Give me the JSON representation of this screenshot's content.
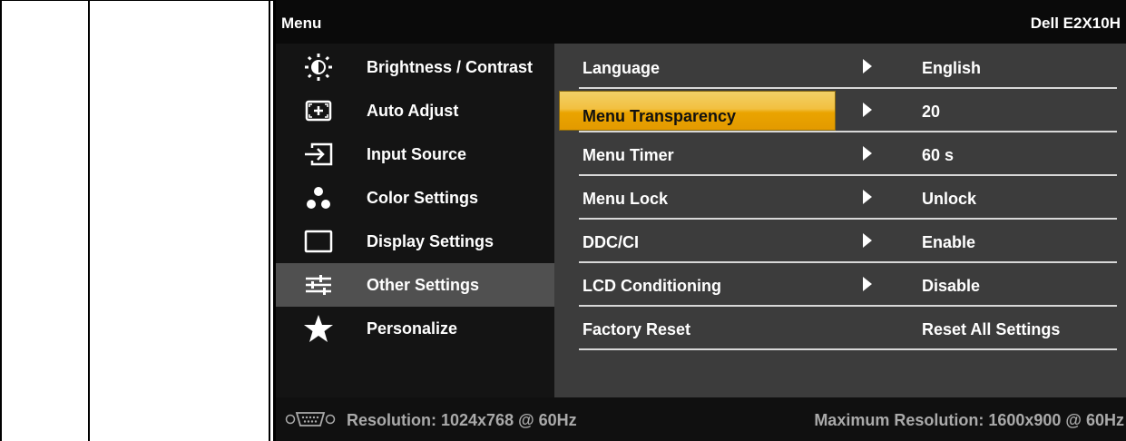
{
  "header": {
    "title": "Menu",
    "model": "Dell E2X10H"
  },
  "main_menu": [
    {
      "label": "Brightness / Contrast",
      "icon": "brightness-icon"
    },
    {
      "label": "Auto Adjust",
      "icon": "auto-adjust-icon"
    },
    {
      "label": "Input Source",
      "icon": "input-source-icon"
    },
    {
      "label": "Color Settings",
      "icon": "color-settings-icon"
    },
    {
      "label": "Display Settings",
      "icon": "display-settings-icon"
    },
    {
      "label": "Other Settings",
      "icon": "other-settings-icon",
      "selected": true
    },
    {
      "label": "Personalize",
      "icon": "star-icon"
    }
  ],
  "other_settings": [
    {
      "name": "Language",
      "value": "English",
      "has_arrow": true
    },
    {
      "name": "Menu Transparency",
      "value": "20",
      "has_arrow": true,
      "highlighted": true
    },
    {
      "name": "Menu Timer",
      "value": "60 s",
      "has_arrow": true
    },
    {
      "name": "Menu Lock",
      "value": "Unlock",
      "has_arrow": true
    },
    {
      "name": "DDC/CI",
      "value": "Enable",
      "has_arrow": true
    },
    {
      "name": "LCD Conditioning",
      "value": "Disable",
      "has_arrow": true
    },
    {
      "name": "Factory Reset",
      "value": "Reset All Settings",
      "has_arrow": false
    }
  ],
  "status": {
    "connector_icon": "vga-connector-icon",
    "resolution": "Resolution: 1024x768 @ 60Hz",
    "max_resolution": "Maximum Resolution: 1600x900 @ 60Hz"
  },
  "colors": {
    "highlight": "#eaa400",
    "title_bg": "#0a0a0a",
    "left_bg": "#141414",
    "right_bg": "#3c3c3c"
  }
}
